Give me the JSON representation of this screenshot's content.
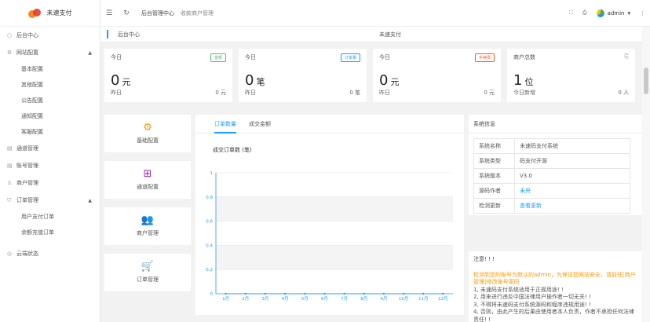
{
  "app": {
    "logo_text": "未速支付"
  },
  "sidebar": {
    "items": [
      {
        "label": "后台中心",
        "icon": "home-icon"
      },
      {
        "label": "网站配置",
        "icon": "gear-icon",
        "expanded": true,
        "children": [
          "基本配置",
          "其他配置",
          "公告配置",
          "通知配置",
          "客服配置"
        ]
      },
      {
        "label": "通道管理",
        "icon": "channel-icon"
      },
      {
        "label": "账号管理",
        "icon": "account-icon"
      },
      {
        "label": "商户管理",
        "icon": "merchant-icon"
      },
      {
        "label": "订单管理",
        "icon": "cart-icon",
        "expanded": true,
        "children": [
          "用户支付订单",
          "余额充值订单"
        ]
      },
      {
        "label": "云端状态",
        "icon": "cloud-icon"
      }
    ]
  },
  "topbar": {
    "breadcrumbs": [
      "后台管理中心",
      "收款商户管理"
    ],
    "username": "admin"
  },
  "page": {
    "title": "后台中心",
    "center_text": "未速支付"
  },
  "cards": [
    {
      "label": "今日",
      "tag": "金额",
      "tag_color": "#5FB878",
      "value": "0",
      "unit": "元",
      "foot_left": "昨日",
      "foot_right": "0 元"
    },
    {
      "label": "今日",
      "tag": "订单量",
      "tag_color": "#1E9FFF",
      "value": "0",
      "unit": "笔",
      "foot_left": "昨日",
      "foot_right": "0 笔"
    },
    {
      "label": "今日",
      "tag": "手续费",
      "tag_color": "#FF5722",
      "value": "0",
      "unit": "元",
      "foot_left": "昨日",
      "foot_right": "0 元"
    },
    {
      "label": "商户总数",
      "tag": "",
      "tag_color": "#999999",
      "value": "1",
      "unit": "位",
      "foot_left": "今日新增",
      "foot_right": "0 人"
    }
  ],
  "tiles": [
    {
      "label": "基础配置",
      "icon": "gear-icon",
      "color": "#FF9800"
    },
    {
      "label": "通道配置",
      "icon": "grid-icon",
      "color": "#9C27B0"
    },
    {
      "label": "商户管理",
      "icon": "users-icon",
      "color": "#1E88E5"
    },
    {
      "label": "订单管理",
      "icon": "cart-icon",
      "color": "#4CAF50"
    }
  ],
  "chart_panel": {
    "tabs": [
      "订单数量",
      "成交金额"
    ],
    "active_tab": 0
  },
  "chart_data": {
    "type": "line",
    "title": "成交订单数 (笔)",
    "categories": [
      "1月",
      "2月",
      "3月",
      "4月",
      "5月",
      "6月",
      "7月",
      "8月",
      "9月",
      "10月",
      "11月",
      "12月"
    ],
    "series": [
      {
        "values": [
          0,
          0,
          0,
          0,
          0,
          0,
          0,
          0,
          0,
          0,
          0,
          0
        ]
      }
    ],
    "ylim": [
      0,
      1
    ],
    "yticks": [
      "0",
      "0.2",
      "0.4",
      "0.6",
      "0.8",
      "1"
    ],
    "color": "#1E9FFF",
    "grid": true
  },
  "system": {
    "title": "系统信息",
    "rows": [
      {
        "k": "系统名称",
        "v": "未速码支付系统",
        "link": false
      },
      {
        "k": "系统类型",
        "v": "码支付开源",
        "link": false
      },
      {
        "k": "系统版本",
        "v": "V3.0",
        "link": false
      },
      {
        "k": "源码作者",
        "v": "未央",
        "link": true
      },
      {
        "k": "检测更新",
        "v": "查看更新",
        "link": true
      }
    ]
  },
  "notice": {
    "title": "注意! ! !",
    "warn": "检测到您的账号为默认的admin，为保证您网站安全，请前往[商户管理]修改账号密码",
    "lines": [
      "1, 未速码支付系统适用于正规用途! !",
      "2, 用来进行违反中国法律用户操作者一切无关! !",
      "3, 不得将未速码支付系统源码和程序违规用途! !",
      "4, 否则，由此产生的后果由使用者本人负责，作者不承担任何法律责任! !"
    ]
  }
}
